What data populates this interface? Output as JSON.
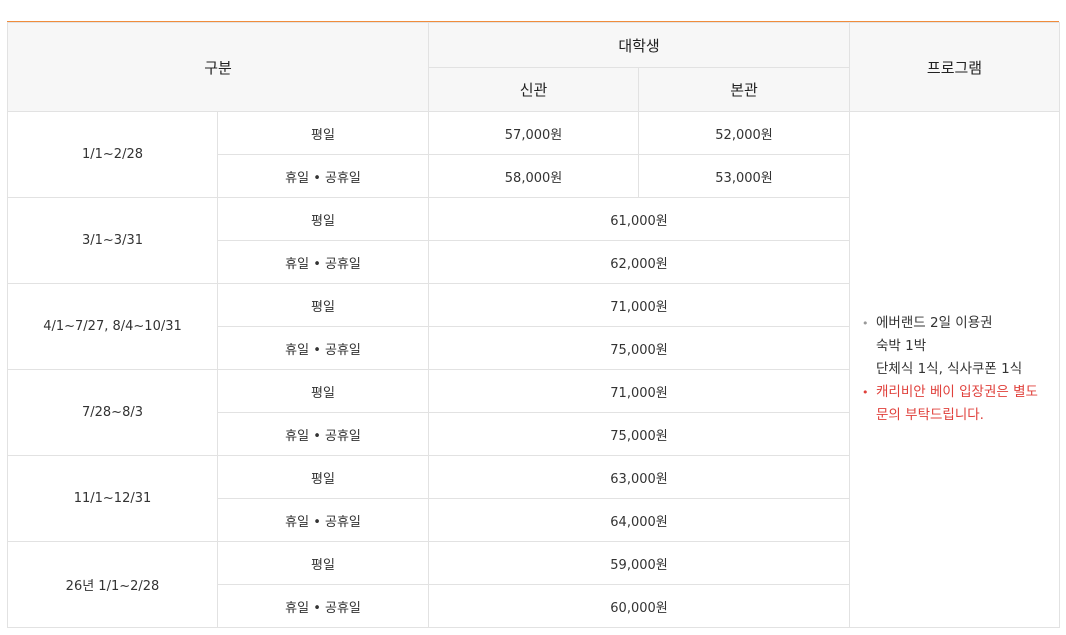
{
  "header": {
    "category": "구분",
    "student_group": "대학생",
    "new_building": "신관",
    "main_building": "본관",
    "program": "프로그램"
  },
  "rows": [
    {
      "period": "1/1~2/28",
      "weekday_label": "평일",
      "weekday_new": "57,000원",
      "weekday_main": "52,000원",
      "holiday_label": "휴일 • 공휴일",
      "holiday_new": "58,000원",
      "holiday_main": "53,000원"
    },
    {
      "period": "3/1~3/31",
      "weekday_label": "평일",
      "weekday_price": "61,000원",
      "holiday_label": "휴일 • 공휴일",
      "holiday_price": "62,000원"
    },
    {
      "period": "4/1~7/27, 8/4~10/31",
      "weekday_label": "평일",
      "weekday_price": "71,000원",
      "holiday_label": "휴일 • 공휴일",
      "holiday_price": "75,000원"
    },
    {
      "period": "7/28~8/3",
      "weekday_label": "평일",
      "weekday_price": "71,000원",
      "holiday_label": "휴일 • 공휴일",
      "holiday_price": "75,000원"
    },
    {
      "period": "11/1~12/31",
      "weekday_label": "평일",
      "weekday_price": "63,000원",
      "holiday_label": "휴일 • 공휴일",
      "holiday_price": "64,000원"
    },
    {
      "period": "26년 1/1~2/28",
      "weekday_label": "평일",
      "weekday_price": "59,000원",
      "holiday_label": "휴일 • 공휴일",
      "holiday_price": "60,000원"
    }
  ],
  "program": {
    "bullet": "•",
    "item1_lines": [
      "에버랜드 2일 이용권",
      "숙박 1박",
      "단체식 1식, 식사쿠폰 1식"
    ],
    "item2_lines": [
      "캐리비안 베이 입장권은 별도",
      "문의 부탁드립니다."
    ]
  },
  "colors": {
    "accent_line": "#f08c3c",
    "notice_red": "#e0413c",
    "header_bg": "#f7f7f7",
    "border": "#e2e2e2"
  }
}
